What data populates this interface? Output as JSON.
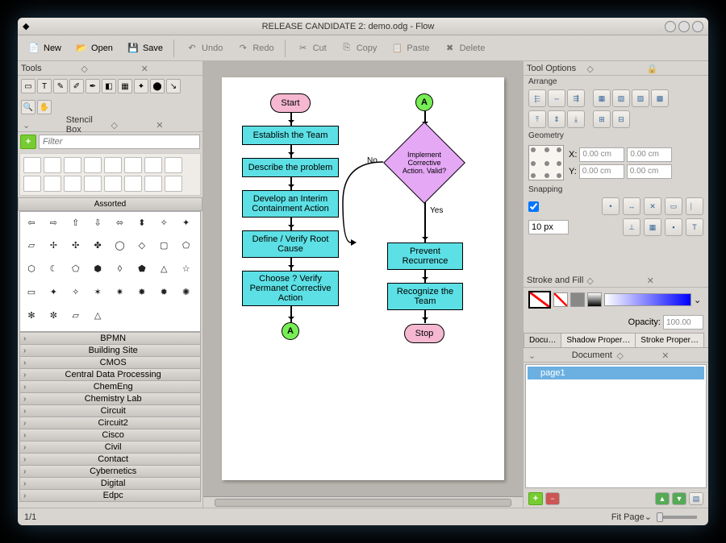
{
  "window": {
    "title": "RELEASE CANDIDATE 2: demo.odg - Flow"
  },
  "toolbar": {
    "new": "New",
    "open": "Open",
    "save": "Save",
    "undo": "Undo",
    "redo": "Redo",
    "cut": "Cut",
    "copy": "Copy",
    "paste": "Paste",
    "delete": "Delete"
  },
  "panels": {
    "tools": "Tools",
    "stencil": "Stencil Box",
    "tool_options": "Tool Options",
    "arrange": "Arrange",
    "geometry": "Geometry",
    "snapping": "Snapping",
    "stroke_fill": "Stroke and Fill",
    "document": "Document"
  },
  "stencil": {
    "filter_placeholder": "Filter",
    "assorted": "Assorted",
    "categories": [
      "BPMN",
      "Building Site",
      "CMOS",
      "Central Data Processing",
      "ChemEng",
      "Chemistry Lab",
      "Circuit",
      "Circuit2",
      "Cisco",
      "Civil",
      "Contact",
      "Cybernetics",
      "Digital",
      "Edpc"
    ]
  },
  "geometry": {
    "x_label": "X:",
    "y_label": "Y:",
    "x_value": "0.00 cm",
    "y_value": "0.00 cm",
    "w_value": "0.00 cm",
    "h_value": "0.00 cm"
  },
  "snapping": {
    "value": "10 px"
  },
  "stroke": {
    "opacity_label": "Opacity:",
    "opacity_value": "100.00"
  },
  "tabs": {
    "docu": "Docu…",
    "shadow": "Shadow Proper…",
    "stroke": "Stroke Proper…"
  },
  "doc": {
    "page": "page1"
  },
  "status": {
    "page": "1/1",
    "fit": "Fit Page"
  },
  "flowchart": {
    "start": "Start",
    "stop": "Stop",
    "connA": "A",
    "n1": "Establish the Team",
    "n2": "Describe the problem",
    "n3": "Develop an Interim Containment Action",
    "n4": "Define / Verify Root Cause",
    "n5": "Choose ? Verify Permanet Corrective Action",
    "d1": "Implement Corrective Action. Valid?",
    "n6": "Prevent Recurrence",
    "n7": "Recognize the Team",
    "no": "No",
    "yes": "Yes"
  }
}
